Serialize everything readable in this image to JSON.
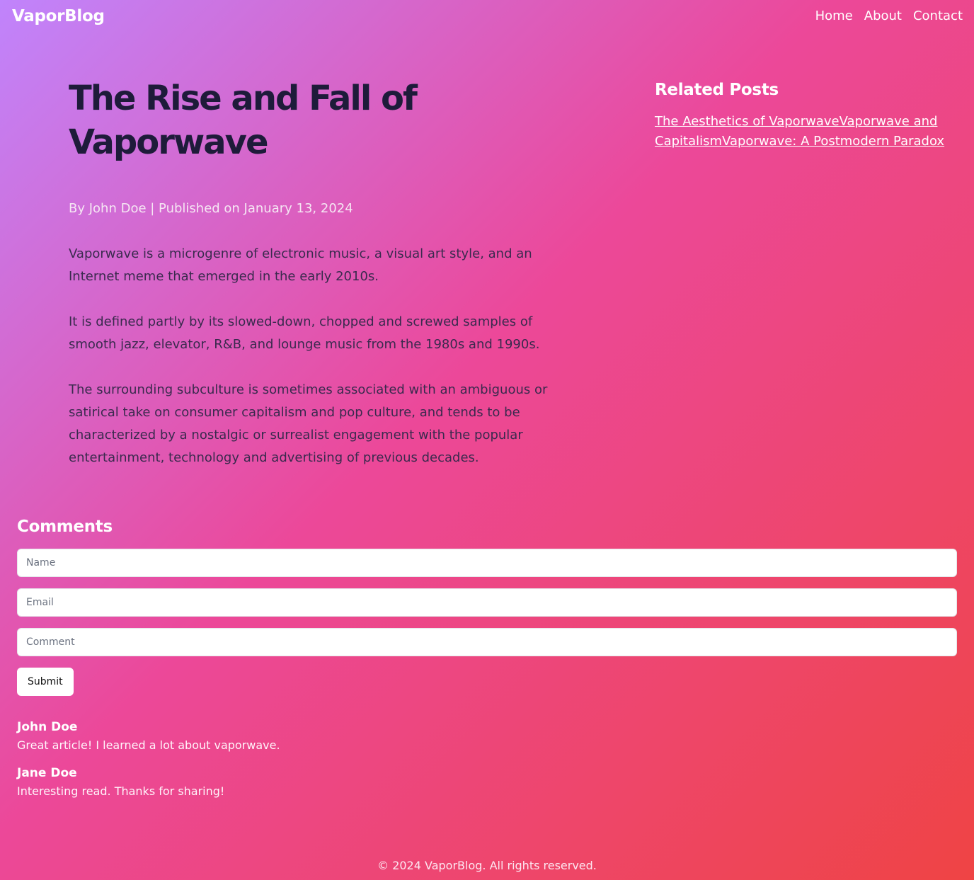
{
  "header": {
    "brand": "VaporBlog",
    "nav": [
      "Home",
      "About",
      "Contact"
    ]
  },
  "article": {
    "title": "The Rise and Fall of Vaporwave",
    "meta": "By John Doe | Published on January 13, 2024",
    "paragraphs": [
      "Vaporwave is a microgenre of electronic music, a visual art style, and an Internet meme that emerged in the early 2010s.",
      "It is defined partly by its slowed-down, chopped and screwed samples of smooth jazz, elevator, R&B, and lounge music from the 1980s and 1990s.",
      "The surrounding subculture is sometimes associated with an ambiguous or satirical take on consumer capitalism and pop culture, and tends to be characterized by a nostalgic or surrealist engagement with the popular entertainment, technology and advertising of previous decades."
    ]
  },
  "related": {
    "heading": "Related Posts",
    "links": [
      "The Aesthetics of Vaporwave",
      "Vaporwave and Capitalism",
      "Vaporwave: A Postmodern Paradox"
    ]
  },
  "comments": {
    "heading": "Comments",
    "name_placeholder": "Name",
    "email_placeholder": "Email",
    "comment_placeholder": "Comment",
    "submit_label": "Submit",
    "items": [
      {
        "author": "John Doe",
        "text": "Great article! I learned a lot about vaporwave."
      },
      {
        "author": "Jane Doe",
        "text": "Interesting read. Thanks for sharing!"
      }
    ]
  },
  "footer": {
    "text": "© 2024 VaporBlog. All rights reserved."
  },
  "colors": {
    "gradient_start": "#c084fc",
    "gradient_mid": "#ec4899",
    "gradient_end": "#ef4444",
    "title": "#1e1b3a"
  }
}
